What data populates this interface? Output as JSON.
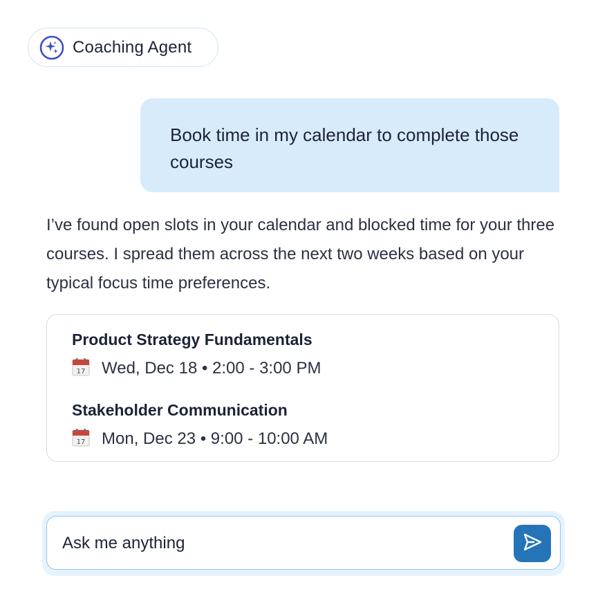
{
  "agent": {
    "name": "Coaching Agent",
    "icon": "sparkle-icon",
    "accent": "#3a4fc7"
  },
  "conversation": {
    "user_message": "Book time in my calendar to complete those courses",
    "agent_reply": "I’ve found open slots in your calendar and blocked time for your three courses. I spread them across the next two weeks based on your typical focus time preferences."
  },
  "events": [
    {
      "title": "Product Strategy Fundamentals",
      "time": "Wed, Dec 18 • 2:00 - 3:00 PM",
      "icon": "calendar-icon",
      "icon_day": "17"
    },
    {
      "title": "Stakeholder Communication",
      "time": "Mon, Dec 23 • 9:00 - 10:00 AM",
      "icon": "calendar-icon",
      "icon_day": "17"
    }
  ],
  "composer": {
    "text": "Ask me anything",
    "send_icon": "send-icon",
    "send_color": "#2574b8"
  }
}
